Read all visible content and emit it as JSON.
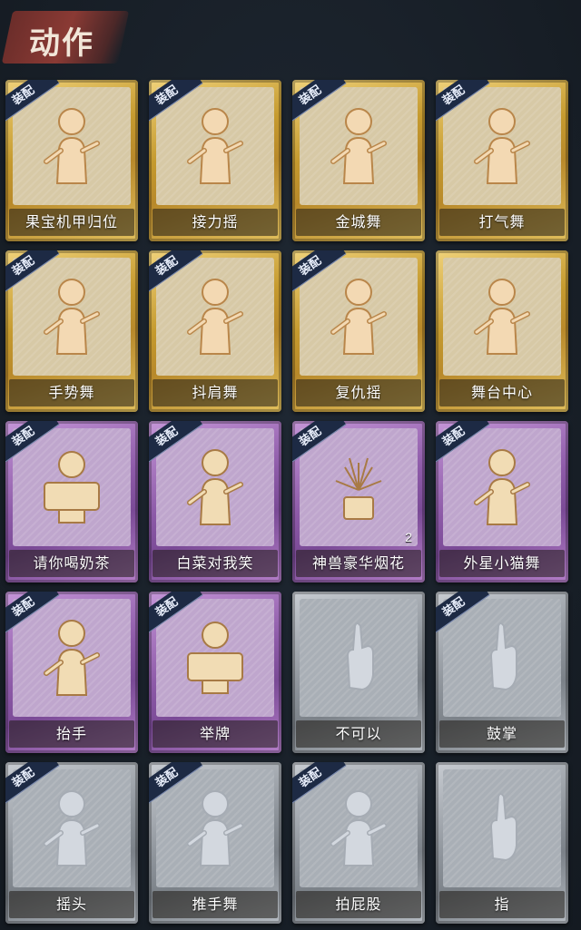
{
  "header": {
    "title": "动作"
  },
  "colors": {
    "gold": "#c59a2e",
    "purple": "#8d5aa8",
    "silver": "#8f959c",
    "tag": "#1d2a44"
  },
  "cards": [
    {
      "label": "果宝机甲归位",
      "rarity": "gold",
      "equipped_tag": "装配",
      "icon": "robot-pose-icon"
    },
    {
      "label": "接力摇",
      "rarity": "gold",
      "equipped_tag": "装配",
      "icon": "relay-dance-icon"
    },
    {
      "label": "金城舞",
      "rarity": "gold",
      "equipped_tag": "装配",
      "icon": "wave-dance-icon"
    },
    {
      "label": "打气舞",
      "rarity": "gold",
      "equipped_tag": "装配",
      "icon": "cheer-dance-icon"
    },
    {
      "label": "手势舞",
      "rarity": "gold",
      "equipped_tag": "装配",
      "icon": "gesture-dance-icon"
    },
    {
      "label": "抖肩舞",
      "rarity": "gold",
      "equipped_tag": "装配",
      "icon": "shoulder-shake-icon"
    },
    {
      "label": "复仇摇",
      "rarity": "gold",
      "equipped_tag": "装配",
      "icon": "revenge-dance-icon"
    },
    {
      "label": "舞台中心",
      "rarity": "gold",
      "equipped_tag": "",
      "icon": "center-stage-icon"
    },
    {
      "label": "请你喝奶茶",
      "rarity": "purple",
      "equipped_tag": "装配",
      "icon": "milk-tea-icon"
    },
    {
      "label": "白菜对我笑",
      "rarity": "purple",
      "equipped_tag": "装配",
      "icon": "cabbage-smile-icon"
    },
    {
      "label": "神兽豪华烟花",
      "rarity": "purple",
      "equipped_tag": "装配",
      "icon": "fireworks-icon",
      "count": "2"
    },
    {
      "label": "外星小猫舞",
      "rarity": "purple",
      "equipped_tag": "装配",
      "icon": "alien-cat-dance-icon"
    },
    {
      "label": "抬手",
      "rarity": "purple",
      "equipped_tag": "装配",
      "icon": "raise-hand-icon"
    },
    {
      "label": "举牌",
      "rarity": "purple",
      "equipped_tag": "装配",
      "icon": "hold-sign-icon"
    },
    {
      "label": "不可以",
      "rarity": "silver",
      "equipped_tag": "",
      "icon": "no-gesture-icon"
    },
    {
      "label": "鼓掌",
      "rarity": "silver",
      "equipped_tag": "装配",
      "icon": "clap-icon"
    },
    {
      "label": "摇头",
      "rarity": "silver",
      "equipped_tag": "装配",
      "icon": "shake-head-icon"
    },
    {
      "label": "推手舞",
      "rarity": "silver",
      "equipped_tag": "装配",
      "icon": "push-hands-icon"
    },
    {
      "label": "拍屁股",
      "rarity": "silver",
      "equipped_tag": "装配",
      "icon": "slap-butt-icon"
    },
    {
      "label": "指",
      "rarity": "silver",
      "equipped_tag": "",
      "icon": "point-icon"
    }
  ]
}
